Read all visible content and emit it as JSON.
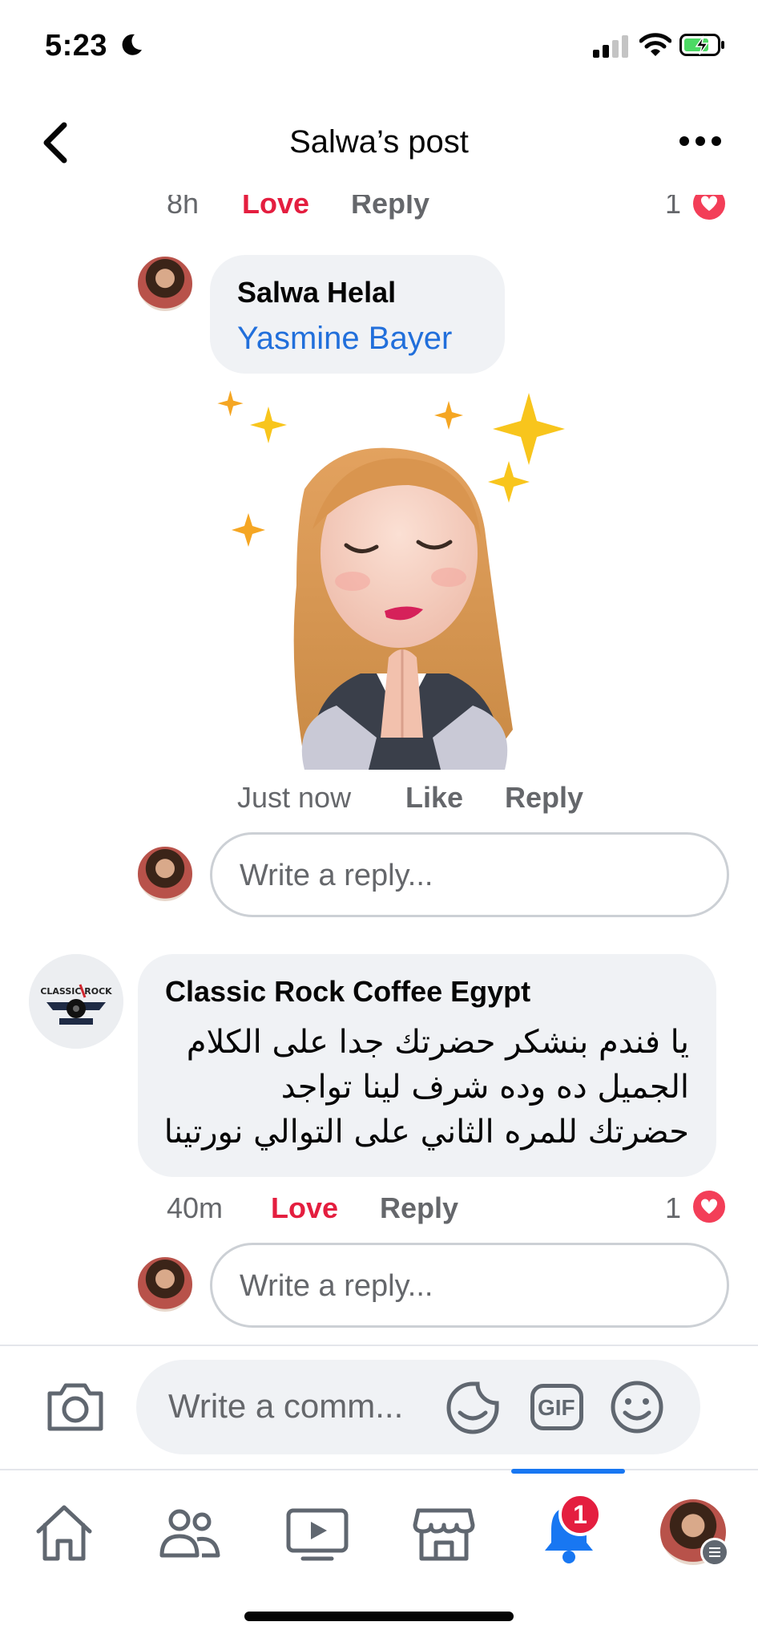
{
  "status_bar": {
    "time": "5:23"
  },
  "header": {
    "title": "Salwa’s post"
  },
  "top_meta": {
    "time": "8h",
    "love": "Love",
    "reply": "Reply",
    "count": "1"
  },
  "reply1": {
    "author": "Salwa Helal",
    "tag": "Yasmine Bayer",
    "meta": {
      "time": "Just now",
      "like": "Like",
      "reply": "Reply"
    }
  },
  "reply_input_1": {
    "placeholder": "Write a reply..."
  },
  "comment2": {
    "author": "Classic Rock Coffee Egypt",
    "lines": [
      "يا فندم بنشكر حضرتك جدا على الكلام",
      "الجميل ده وده شرف لينا تواجد",
      "حضرتك للمره الثاني على التوالي نورتينا"
    ],
    "meta": {
      "time": "40m",
      "love": "Love",
      "reply": "Reply",
      "count": "1"
    }
  },
  "reply_input_2": {
    "placeholder": "Write a reply..."
  },
  "composer": {
    "placeholder": "Write a comm...",
    "gif_label": "GIF"
  },
  "nav": {
    "notifications_badge": "1"
  },
  "colors": {
    "accent": "#1877f2",
    "love": "#e41e3f",
    "tag": "#216fdb",
    "bubble": "#f0f2f5"
  },
  "icons": [
    "moon-icon",
    "signal-icon",
    "wifi-icon",
    "battery-icon",
    "back-icon",
    "more-icon",
    "heart-icon",
    "camera-icon",
    "sticker-icon",
    "gif-icon",
    "emoji-icon",
    "home-icon",
    "friends-icon",
    "watch-icon",
    "marketplace-icon",
    "bell-icon",
    "profile-avatar"
  ]
}
